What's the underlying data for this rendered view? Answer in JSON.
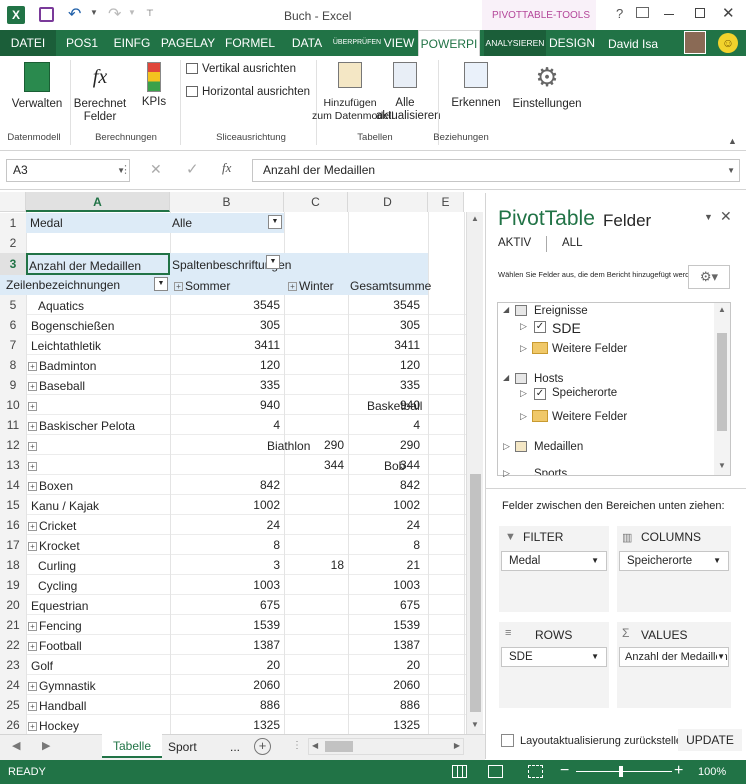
{
  "title": {
    "text": "Buch - Excel",
    "context": "PIVOTTABLE-TOOLS"
  },
  "tabs": [
    "DATEI",
    "POS1",
    "EINFG",
    "PAGELAY",
    "FORMEL",
    "DATA",
    "ÜBERPRÜFEN",
    "VIEW",
    "POWERPI",
    "ANALYSIEREN",
    "DESIGN"
  ],
  "user": "David Isa",
  "ribbon": {
    "manage": "Verwalten",
    "calc1": "Berechnet",
    "calc2": "Felder",
    "kpis": "KPIs",
    "vert": "Vertikal ausrichten",
    "horiz": "Horizontal ausrichten",
    "add1": "Hinzufügen",
    "add2": "zum Datenmodell",
    "refresh1": "Alle",
    "refresh2": "aktualisieren",
    "detect": "Erkennen",
    "settings": "Einstellungen",
    "g_datamodel": "Datenmodell",
    "g_calc": "Berechnungen",
    "g_slicer": "Sliceausrichtung",
    "g_tables": "Tabellen",
    "g_rel": "Beziehungen"
  },
  "formula": {
    "namebox": "A3",
    "content": "Anzahl der Medaillen"
  },
  "columns": [
    "A",
    "B",
    "C",
    "D",
    "E"
  ],
  "grid": {
    "r1a": "Medal",
    "r1b": "Alle",
    "r3a": "Anzahl der Medaillen",
    "r3b": "Spaltenbeschriftungen",
    "r4a": "Zeilenbezeichnungen",
    "r4b": "Sommer",
    "r4c": "Winter",
    "r4d": "Gesamtsumme"
  },
  "rows": [
    {
      "n": "5",
      "name": "Aquatics",
      "b": "3545",
      "c": "",
      "d": "3545",
      "plus": false
    },
    {
      "n": "6",
      "name": "Bogenschießen",
      "b": "305",
      "c": "",
      "d": "305",
      "plus": false
    },
    {
      "n": "7",
      "name": "Leichtathletik",
      "b": "3411",
      "c": "",
      "d": "3411",
      "plus": false
    },
    {
      "n": "8",
      "name": "Badminton",
      "b": "120",
      "c": "",
      "d": "120",
      "plus": true
    },
    {
      "n": "9",
      "name": "Baseball",
      "b": "335",
      "c": "",
      "d": "335",
      "plus": true
    },
    {
      "n": "10",
      "name": "",
      "b": "940",
      "c": "",
      "d": "940",
      "plus": true
    },
    {
      "n": "11",
      "name": "Baskischer Pelota",
      "b": "4",
      "c": "",
      "d": "4",
      "plus": true
    },
    {
      "n": "12",
      "name": "",
      "b": "",
      "c": "290",
      "d": "290",
      "plus": true
    },
    {
      "n": "13",
      "name": "",
      "b": "",
      "c": "344",
      "d": "344",
      "plus": true
    },
    {
      "n": "14",
      "name": "Boxen",
      "b": "842",
      "c": "",
      "d": "842",
      "plus": true
    },
    {
      "n": "15",
      "name": "Kanu / Kajak",
      "b": "1002",
      "c": "",
      "d": "1002",
      "plus": false
    },
    {
      "n": "16",
      "name": "Cricket",
      "b": "24",
      "c": "",
      "d": "24",
      "plus": true
    },
    {
      "n": "17",
      "name": "Krocket",
      "b": "8",
      "c": "",
      "d": "8",
      "plus": true
    },
    {
      "n": "18",
      "name": "Curling",
      "b": "3",
      "c": "18",
      "d": "21",
      "plus": false
    },
    {
      "n": "19",
      "name": "Cycling",
      "b": "1003",
      "c": "",
      "d": "1003",
      "plus": false
    },
    {
      "n": "20",
      "name": "Equestrian",
      "b": "675",
      "c": "",
      "d": "675",
      "plus": false
    },
    {
      "n": "21",
      "name": "Fencing",
      "b": "1539",
      "c": "",
      "d": "1539",
      "plus": true
    },
    {
      "n": "22",
      "name": "Football",
      "b": "1387",
      "c": "",
      "d": "1387",
      "plus": true
    },
    {
      "n": "23",
      "name": "Golf",
      "b": "20",
      "c": "",
      "d": "20",
      "plus": false
    },
    {
      "n": "24",
      "name": "Gymnastik",
      "b": "2060",
      "c": "",
      "d": "2060",
      "plus": true
    },
    {
      "n": "25",
      "name": "Handball",
      "b": "886",
      "c": "",
      "d": "886",
      "plus": true
    },
    {
      "n": "26",
      "name": "Hockey",
      "b": "1325",
      "c": "",
      "d": "1325",
      "plus": true
    }
  ],
  "overflow": {
    "basketball": "Basketball",
    "biathlon": "Biathlon",
    "bob": "Bob"
  },
  "sheets": {
    "active": "Tabelle",
    "other": "Sport",
    "more": "..."
  },
  "pane": {
    "title1": "PivotTable",
    "title2": "Felder",
    "tab_active": "AKTIV",
    "tab_all": "ALL",
    "hint": "Wählen Sie Felder aus, die dem Bericht hinzugefügt werden sollen:",
    "tree": {
      "t1": "Ereignisse",
      "t1a": "SDE",
      "t1b": "Weitere Felder",
      "t2": "Hosts",
      "t2a": "Speicherorte",
      "t2b": "Weitere Felder",
      "t3": "Medaillen",
      "t4": "Sports"
    },
    "drag": "Felder zwischen den Bereichen unten ziehen:",
    "filter": "FILTER",
    "columns": "COLUMNS",
    "rows": "ROWS",
    "values": "VALUES",
    "filter_val": "Medal",
    "columns_val": "Speicherorte",
    "rows_val": "SDE",
    "values_val": "Anzahl der Medaillen",
    "defer": "Layoutaktualisierung zurückstellen",
    "update": "UPDATE"
  },
  "status": {
    "ready": "READY",
    "zoom": "100%"
  }
}
